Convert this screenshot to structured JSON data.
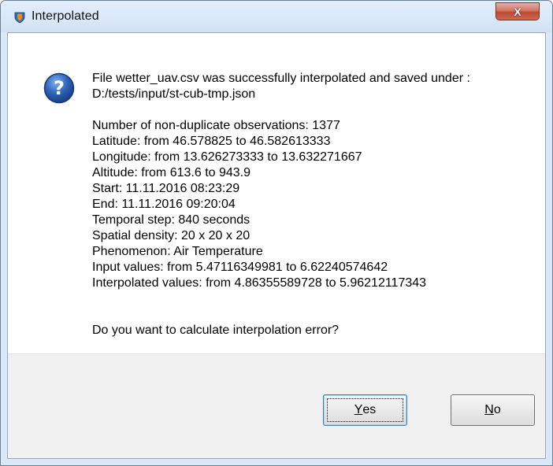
{
  "window": {
    "title": "Interpolated",
    "close_glyph": "X"
  },
  "message": {
    "intro_lines": [
      "File wetter_uav.csv was successfully interpolated and saved under :",
      "D:/tests/input/st-cub-tmp.json"
    ],
    "details": [
      "Number of non-duplicate observations: 1377",
      "Latitude: from 46.578825 to 46.582613333",
      "Longitude: from 13.626273333 to 13.632271667",
      "Altitude: from 613.6 to 943.9",
      "Start: 11.11.2016 08:23:29",
      "End: 11.11.2016 09:20:04",
      "Temporal step: 840 seconds",
      "Spatial density: 20 x 20 x 20",
      "Phenomenon: Air Temperature",
      "Input values: from 5.47116349981 to 6.62240574642",
      "Interpolated values: from 4.86355589728 to 5.96212117343"
    ],
    "question": "Do you want to calculate interpolation error?"
  },
  "buttons": {
    "yes": {
      "mnemonic": "Y",
      "rest": "es"
    },
    "no": {
      "mnemonic": "N",
      "rest": "o"
    }
  },
  "icons": {
    "app": "shield-app-icon",
    "question": "question-icon"
  },
  "colors": {
    "question_icon": "#2e64b8",
    "close_button": "#c9533c",
    "button_bar": "#f0f0f0"
  }
}
